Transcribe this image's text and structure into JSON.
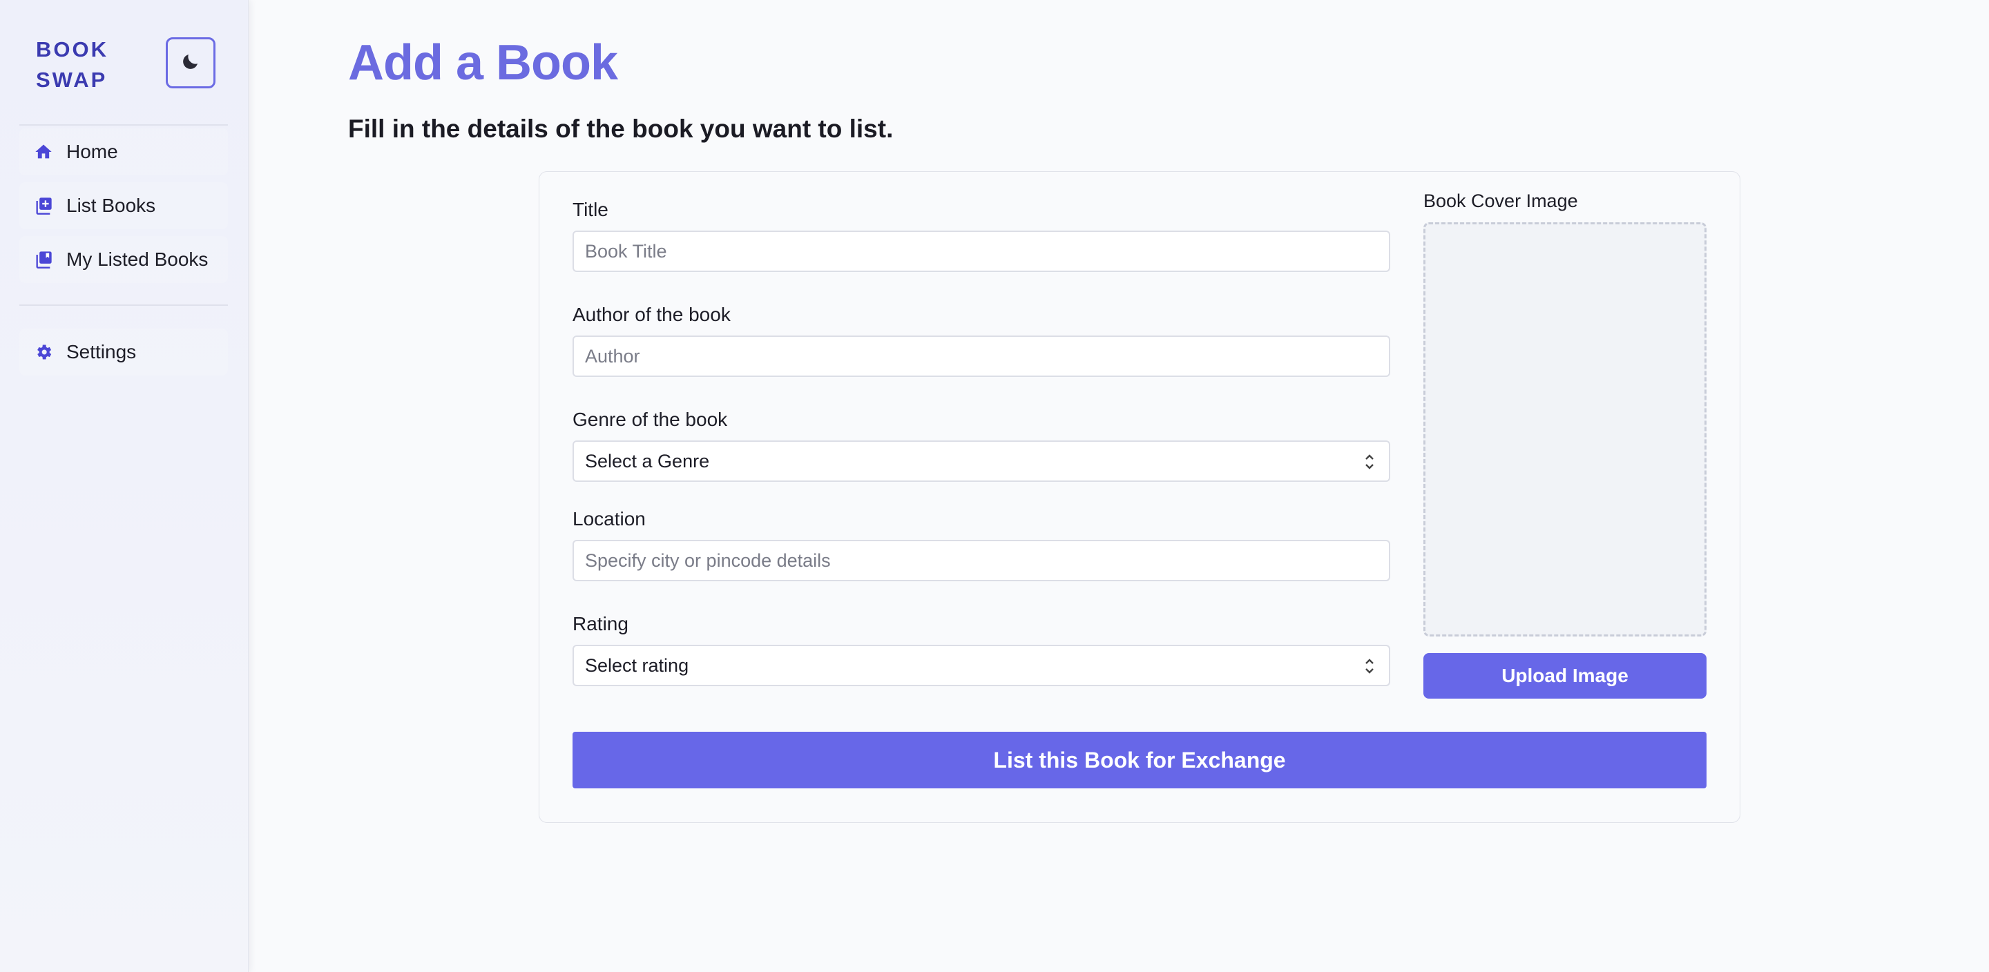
{
  "sidebar": {
    "brand": "BOOK SWAP",
    "theme_toggle_icon": "moon-icon",
    "items": [
      {
        "label": "Home",
        "icon": "home-icon"
      },
      {
        "label": "List Books",
        "icon": "add-book-icon"
      },
      {
        "label": "My Listed Books",
        "icon": "library-icon"
      }
    ],
    "settings": {
      "label": "Settings",
      "icon": "gear-icon"
    }
  },
  "main": {
    "title": "Add a Book",
    "subtitle": "Fill in the details of the book you want to list."
  },
  "form": {
    "title_label": "Title",
    "title_placeholder": "Book Title",
    "author_label": "Author of the book",
    "author_placeholder": "Author",
    "genre_label": "Genre of the book",
    "genre_value": "Select a Genre",
    "location_label": "Location",
    "location_placeholder": "Specify city or pincode details",
    "rating_label": "Rating",
    "rating_value": "Select rating",
    "cover_label": "Book Cover Image",
    "upload_label": "Upload Image",
    "submit_label": "List this Book for Exchange"
  },
  "colors": {
    "accent": "#6767e8",
    "brand": "#3b3bb0",
    "title": "#6b6be0"
  }
}
